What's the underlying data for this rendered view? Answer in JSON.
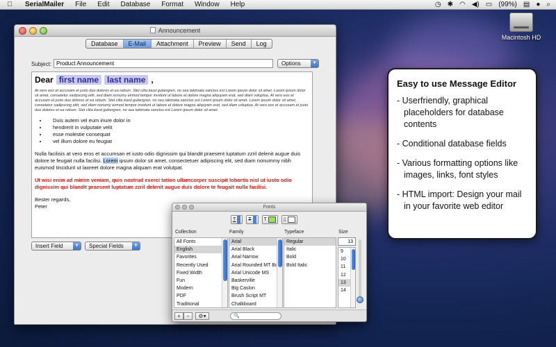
{
  "menubar": {
    "app": "SerialMailer",
    "items": [
      "File",
      "Edit",
      "Database",
      "Format",
      "Window",
      "Help"
    ],
    "battery": "(99%)"
  },
  "desktop": {
    "drive_label": "Macintosh HD"
  },
  "window": {
    "title": "Announcement",
    "tabs": [
      {
        "label": "Database",
        "active": false
      },
      {
        "label": "E-Mail",
        "active": true
      },
      {
        "label": "Attachment",
        "active": false
      },
      {
        "label": "Preview",
        "active": false
      },
      {
        "label": "Send",
        "active": false
      },
      {
        "label": "Log",
        "active": false
      }
    ],
    "subject_label": "Subject:",
    "subject_value": "Product Announcement",
    "options_label": "Options",
    "insert_field": "Insert Field",
    "special_fields": "Special Fields"
  },
  "message": {
    "dear": "Dear",
    "ph_first": "first name",
    "ph_last": "last name",
    "comma": ",",
    "small_para1": "At vero eos et accusam et justo duo dolores et ea rebum. Stet clita kasd gubergren, no sea takimata sanctus est Lorem ipsum dolor sit amet. Lorem ipsum dolor sit amet, consetetur sadipscing elitr, sed diam nonumy eirmod tempor invidunt ut labore et dolore magna aliquyam erat, sed diam voluptua. At vero eos et accusam et justo duo dolores et ea rebum. Stet clita kasd gubergren, no sea takimata sanctus est Lorem ipsum dolor sit amet. Lorem ipsum dolor sit amet, consetetur sadipscing elitr, sed diam nonumy eirmod tempor invidunt ut labore et dolore magna aliquyam erat, sed diam voluptua. At vero eos et accusam et justo duo dolores et ea rebum. Stet clita kasd gubergren, no sea takimata sanctus est Lorem ipsum dolor sit amet.",
    "bullets": [
      "Duis autem vel eum iriure dolor in",
      "hendrerit in vulputate velit",
      "esse molestie consequat",
      "vel illum dolore eu feugiat"
    ],
    "para_pre": "Nulla facilisis at vero eros et accumsan et iusto odio dignissim qui blandit praesent luptatum zzril delenit augue duis dolore te feugait nulla facilisi.",
    "para_sel": "Lorem",
    "para_post": "ipsum dolor sit amet, consectetuer adipiscing elit, sed diam nonummy nibh euismod tincidunt ut laoreet dolore magna aliquam erat volutpat.",
    "red_para": "Ut wisi enim ad minim veniam, quis nostrud exerci tation ullamcorper suscipit lobortis nisl ut iusto odio dignissim qui blandit praesent luptatum zzril delenit augue duis dolore te feugait nulla facilisi.",
    "sign1": "Bester regards,",
    "sign2": "Peter"
  },
  "fonts_panel": {
    "title": "Fonts",
    "headers": {
      "collection": "Collection",
      "family": "Family",
      "typeface": "Typeface",
      "size": "Size"
    },
    "collections": [
      "All Fonts",
      "English",
      "Favorites",
      "Recently Used",
      "Fixed Width",
      "Fun",
      "Modern",
      "PDF",
      "Traditional"
    ],
    "families": [
      "Arial",
      "Arial Black",
      "Arial Narrow",
      "Arial Rounded MT Bold",
      "Arial Unicode MS",
      "Baskerville",
      "Big Caslon",
      "Brush Script MT",
      "Chalkboard"
    ],
    "typefaces": [
      "Regular",
      "Italic",
      "Bold",
      "Bold Italic"
    ],
    "sizes": [
      "9",
      "10",
      "11",
      "12",
      "13",
      "14"
    ],
    "size_value": "13",
    "selected": {
      "collection": 1,
      "family": 0,
      "typeface": 0,
      "size": 4
    },
    "add": "+",
    "remove": "−",
    "gear": "⚙▾",
    "search_glyph": "🔍",
    "text_color": "#8ee84a"
  },
  "callout": {
    "title": "Easy to use Message Editor",
    "points": [
      "- Userfriendly, graphical placeholders for database contents",
      "- Conditional database fields",
      "- Various formatting options like images, links, font styles",
      "- HTML import: Design your mail in your favorite web editor"
    ]
  }
}
